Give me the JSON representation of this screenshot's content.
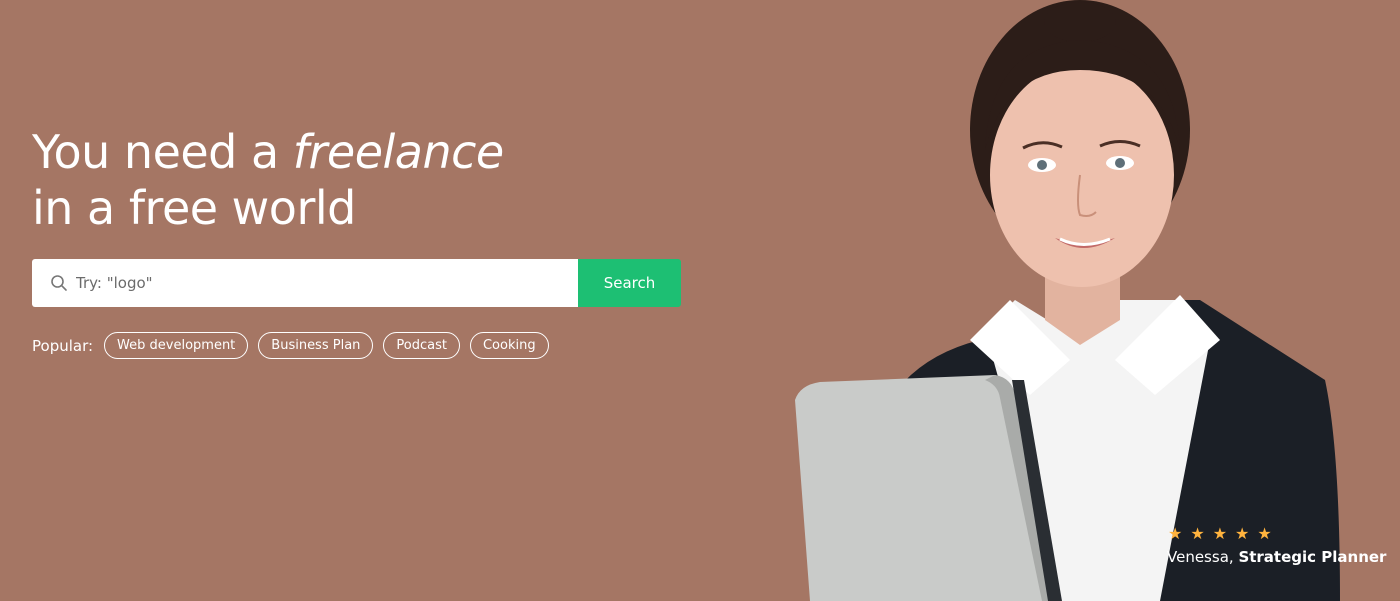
{
  "hero": {
    "title_line1_prefix": "You need a ",
    "title_line1_emphasis": "freelance",
    "title_line2": "in a free world"
  },
  "search": {
    "placeholder": "Try: \"logo\"",
    "button_label": "Search",
    "icon": "search-icon"
  },
  "popular": {
    "label": "Popular:",
    "tags": [
      "Web development",
      "Business Plan",
      "Podcast",
      "Cooking"
    ]
  },
  "testimonial": {
    "rating": 5,
    "name": "Venessa,",
    "role": "Strategic Planner"
  },
  "colors": {
    "background": "#a57664",
    "accent": "#1dbf73",
    "star": "#ffb33e"
  }
}
